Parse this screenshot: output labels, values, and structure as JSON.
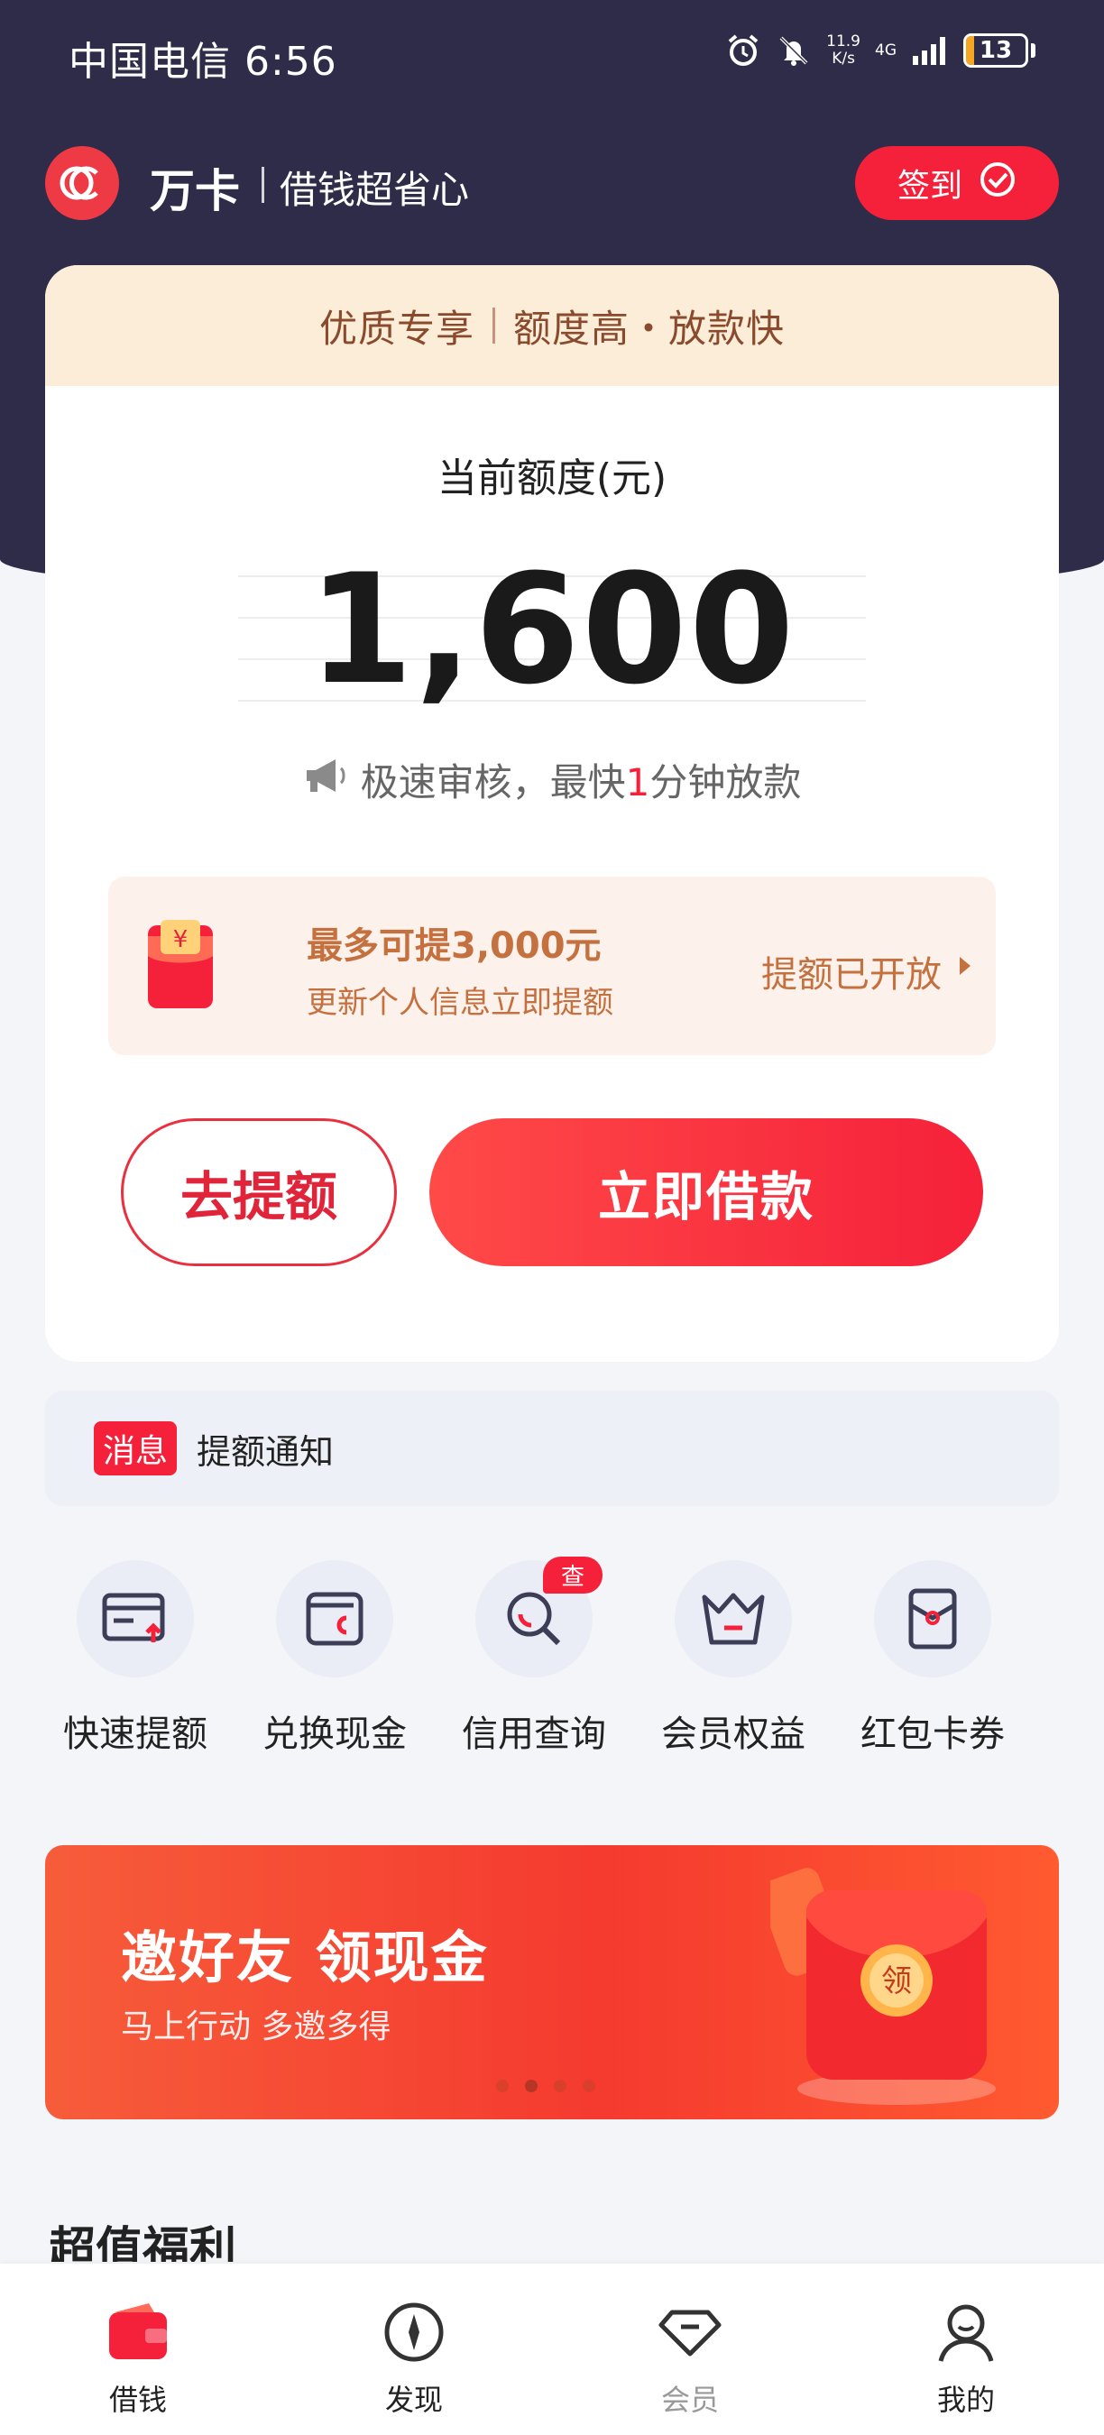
{
  "status_bar": {
    "carrier_time": "中国电信 6:56",
    "speed_value": "11.9",
    "speed_unit": "K/s",
    "network": "4G",
    "battery": "13"
  },
  "header": {
    "brand": "万卡",
    "slogan": "借钱超省心",
    "checkin_label": "签到"
  },
  "credit_card": {
    "banner_left": "优质专享",
    "banner_right": "额度高・放款快",
    "limit_label": "当前额度(元)",
    "limit_amount": "1,600",
    "notice_prefix": "极速审核，最快",
    "notice_highlight": "1",
    "notice_suffix": "分钟放款",
    "raise_title": "最多可提3,000元",
    "raise_subtitle": "更新个人信息立即提额",
    "raise_status": "提额已开放",
    "btn_raise": "去提额",
    "btn_borrow": "立即借款"
  },
  "message": {
    "badge": "消息",
    "text": "提额通知"
  },
  "quick_menu": [
    {
      "label": "快速提额",
      "icon": "card-up-icon"
    },
    {
      "label": "兑换现金",
      "icon": "wallet-icon"
    },
    {
      "label": "信用查询",
      "icon": "search-icon",
      "badge": "查"
    },
    {
      "label": "会员权益",
      "icon": "crown-icon"
    },
    {
      "label": "红包卡券",
      "icon": "red-envelope-icon"
    }
  ],
  "promo": {
    "title": "邀好友 领现金",
    "subtitle": "马上行动 多邀多得",
    "art_text": "领",
    "slides": 4,
    "active_slide": 2
  },
  "section_title": "超值福利",
  "bottom_nav": [
    {
      "label": "借钱",
      "icon": "wallet-icon",
      "active": true
    },
    {
      "label": "发现",
      "icon": "compass-icon"
    },
    {
      "label": "会员",
      "icon": "diamond-icon",
      "muted": true
    },
    {
      "label": "我的",
      "icon": "user-icon"
    }
  ],
  "colors": {
    "brand_red": "#f5213a",
    "dark_header": "#2e2c48",
    "gold_text": "#c4713f"
  }
}
